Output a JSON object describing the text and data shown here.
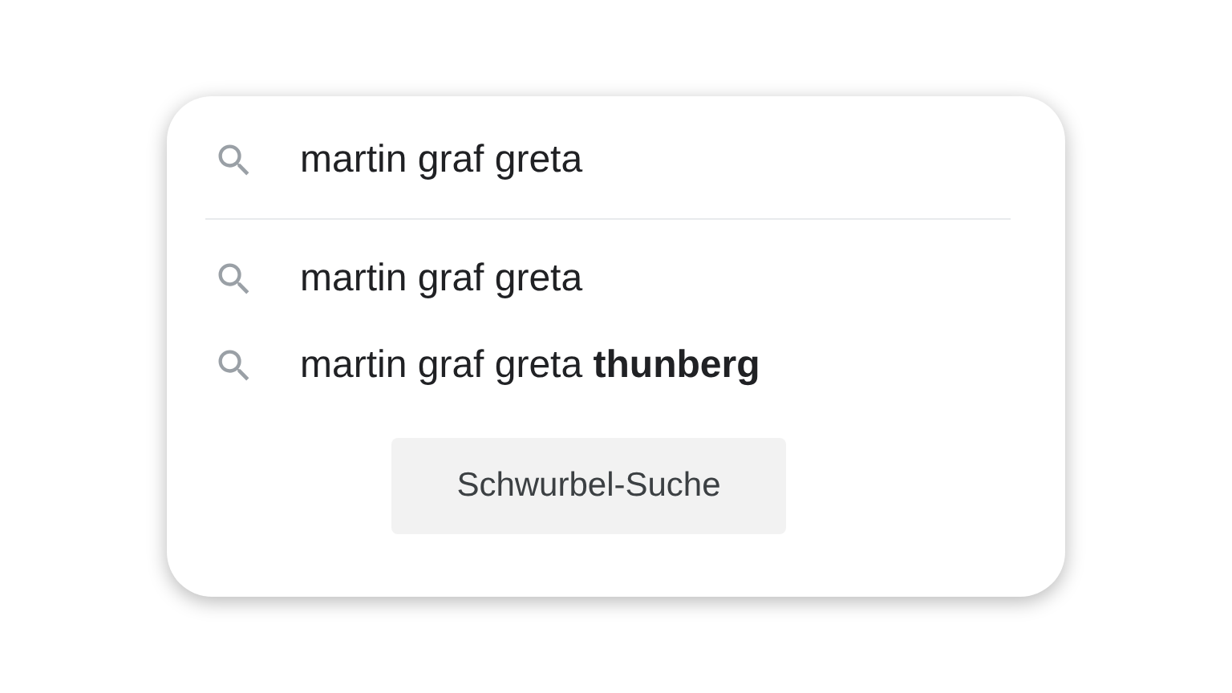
{
  "search": {
    "value": "martin graf greta"
  },
  "suggestions": [
    {
      "text": "martin graf greta"
    },
    {
      "text": "martin graf greta **thunberg**"
    }
  ],
  "button": {
    "label": "Schwurbel-Suche"
  }
}
